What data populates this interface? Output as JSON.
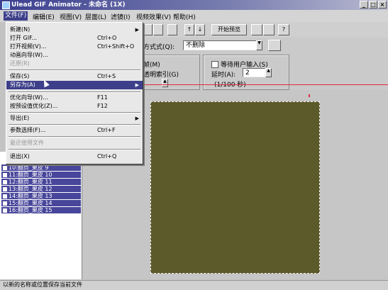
{
  "window": {
    "title": "Ulead GIF Animator - 未命名 (1X)",
    "controls": [
      "_",
      "□",
      "×"
    ]
  },
  "menubar": [
    "文件(F)",
    "编辑(E)",
    "视图(V)",
    "层面(L)",
    "滤镜(I)",
    "视频效果(V)",
    "帮助(H)"
  ],
  "file_menu": [
    {
      "label": "新建(N)",
      "shortcut": "",
      "submenu": true
    },
    {
      "label": "打开 GIF...",
      "shortcut": "Ctrl+O"
    },
    {
      "label": "打开视频(V)...",
      "shortcut": "Ctrl+Shift+O"
    },
    {
      "label": "动画向导(W)...",
      "shortcut": ""
    },
    {
      "label": "还原(R)",
      "shortcut": "",
      "disabled": true
    },
    {
      "label": "保存(S)",
      "shortcut": "Ctrl+S"
    },
    {
      "label": "另存为(A)",
      "shortcut": "",
      "submenu": true,
      "highlighted": true
    },
    {
      "label": "优化向导(W)...",
      "shortcut": "F11"
    },
    {
      "label": "按预设值优化(Z)...",
      "shortcut": "F12"
    },
    {
      "label": "导出(E)",
      "shortcut": "",
      "submenu": true
    },
    {
      "label": "参数选择(F)...",
      "shortcut": "Ctrl+F"
    },
    {
      "label": "最近使用文件",
      "shortcut": "",
      "disabled": true
    },
    {
      "label": "退出(X)",
      "shortcut": "Ctrl+Q"
    }
  ],
  "toolbar": {
    "preview_button": "开始预览"
  },
  "panel": {
    "method_label": "方式式(Q):",
    "method_value": "不删除",
    "frame_label": "帧(M)",
    "index_label": "透明索引(G)",
    "wait_label": "等待用户输入(S)",
    "delay_label": "延时(A):",
    "delay_value": "2",
    "delay_unit": "(1/100 秒)"
  },
  "frames": [
    {
      "label": "10:翻页_果皮 9"
    },
    {
      "label": "11:翻页_果皮 10"
    },
    {
      "label": "12:翻页_果皮 11"
    },
    {
      "label": "13:翻页_果皮 12"
    },
    {
      "label": "14:翻页_果皮 13"
    },
    {
      "label": "15:翻页_果皮 14"
    },
    {
      "label": "16:翻页_果皮 15"
    }
  ],
  "status": "以新的名称或位置保存当前文件",
  "colors": {
    "canvas": "#5c5a2a",
    "highlight": "#3d3f8a",
    "frame_selected": "#48469a",
    "guide": "#e02a40"
  }
}
